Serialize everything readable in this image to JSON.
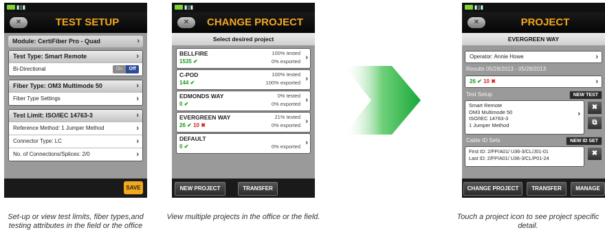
{
  "screen1": {
    "title": "TEST SETUP",
    "module": "Module: CertiFiber Pro - Quad",
    "test_type_header": "Test Type: Smart Remote",
    "bidirectional_label": "Bi-Directional",
    "toggle_on": "On",
    "toggle_off": "Off",
    "fiber_type_header": "Fiber Type: OM3 Multimode 50",
    "fiber_type_settings": "Fiber Type Settings",
    "test_limit_header": "Test Limit: ISO/IEC 14763-3",
    "reference_method": "Reference Method: 1 Jumper Method",
    "connector_type": "Connector Type: LC",
    "connections": "No. of Connections/Splices: 2/0",
    "save_label": "SAVE",
    "caption": "Set-up or view test limits, fiber types,and testing attributes in the field or the office"
  },
  "screen2": {
    "title": "CHANGE PROJECT",
    "subheader": "Select desired project",
    "projects": [
      {
        "name": "BELLFIRE",
        "pass": "1535",
        "fail": "",
        "tested": "100% tested",
        "exported": "0% exported"
      },
      {
        "name": "C-POD",
        "pass": "144",
        "fail": "",
        "tested": "100% tested",
        "exported": "100% exported"
      },
      {
        "name": "EDMONDS WAY",
        "pass": "0",
        "fail": "",
        "tested": "0% tested",
        "exported": "0% exported"
      },
      {
        "name": "EVERGREEN WAY",
        "pass": "26",
        "fail": "10",
        "tested": "21% tested",
        "exported": "0% exported"
      },
      {
        "name": "DEFAULT",
        "pass": "0",
        "fail": "",
        "tested": "",
        "exported": "0% exported"
      }
    ],
    "new_project_label": "NEW PROJECT",
    "transfer_label": "TRANSFER",
    "caption": "View multiple projects in the office or the field."
  },
  "screen3": {
    "title": "PROJECT",
    "project_name": "EVERGREEN WAY",
    "operator": "Operator: Annie Howe",
    "results": "Results 05/28/2013 - 05/28/2013",
    "pass_count": "26",
    "fail_count": "10",
    "test_setup_label": "Test Setup",
    "new_test_label": "NEW TEST",
    "setup_lines": [
      "Smart Remote",
      "OM3 Multimode 50",
      "ISO/IEC 14763-3",
      "1 Jumper Method"
    ],
    "cable_id_label": "Cable ID Sets",
    "new_id_set_label": "NEW ID SET",
    "first_id": "First ID: 2/FP/A01/ U36-3/CL/J01-01",
    "last_id": "Last ID: 2/FP/A01/ U36-3/CL/P01-24",
    "change_project_label": "CHANGE PROJECT",
    "transfer_label": "TRANSFER",
    "manage_label": "MANAGE",
    "caption": "Touch a project icon to see project specific detail."
  },
  "colors": {
    "accent": "#f4a81e",
    "pass": "#1a9a1a",
    "fail": "#d02020",
    "arrow": "#2db34a"
  }
}
